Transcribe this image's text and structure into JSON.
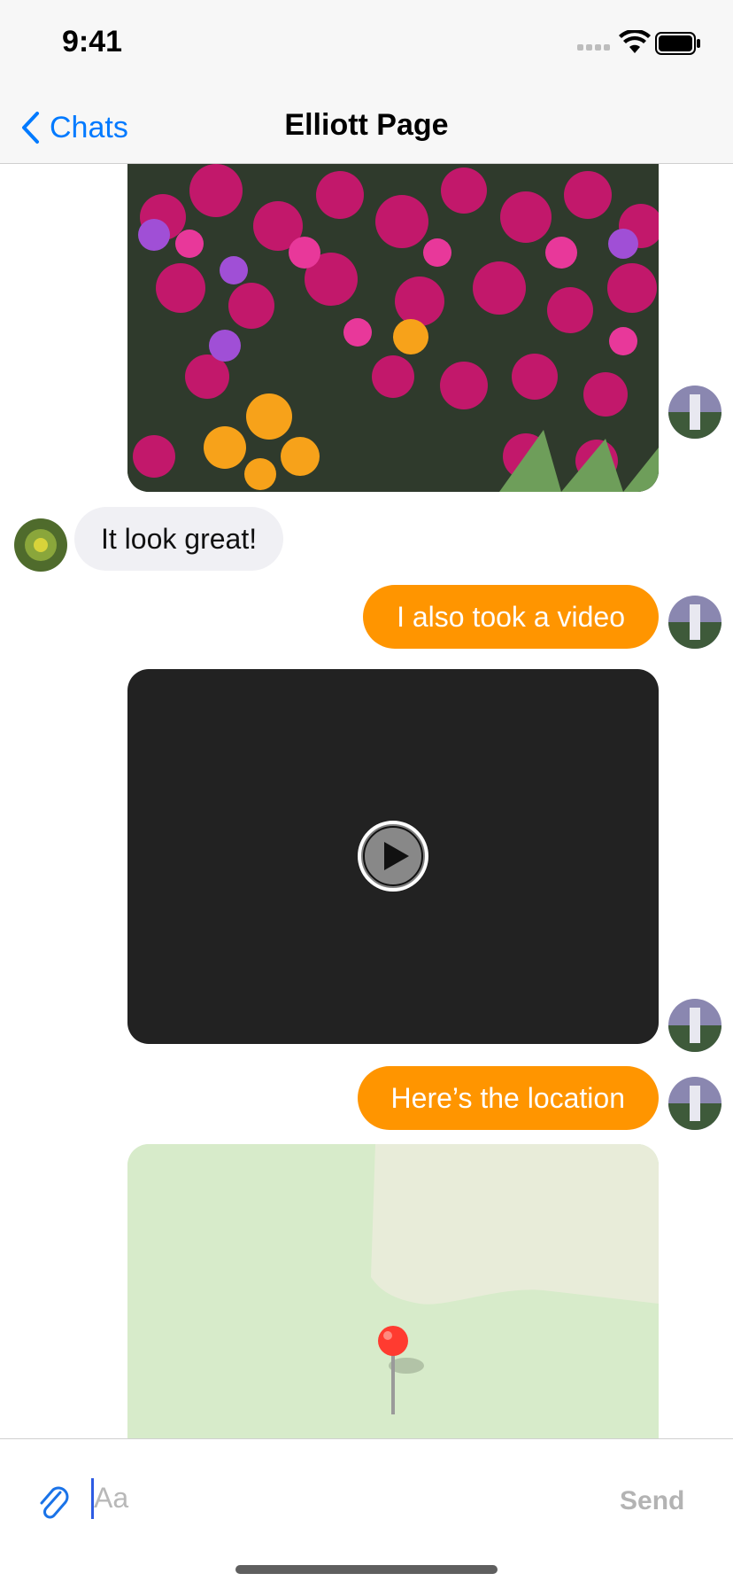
{
  "status_bar": {
    "time": "9:41"
  },
  "nav": {
    "back_label": "Chats",
    "title": "Elliott Page"
  },
  "messages": [
    {
      "type": "image",
      "direction": "outgoing",
      "content": "pink and yellow flowers photo"
    },
    {
      "type": "text",
      "direction": "incoming",
      "text": "It look great!"
    },
    {
      "type": "text",
      "direction": "outgoing",
      "text": "I also took a video"
    },
    {
      "type": "video",
      "direction": "outgoing"
    },
    {
      "type": "text",
      "direction": "outgoing",
      "text": "Here’s the location"
    },
    {
      "type": "location",
      "direction": "outgoing"
    }
  ],
  "input": {
    "placeholder": "Aa",
    "value": "",
    "send_label": "Send"
  },
  "colors": {
    "accent": "#007aff",
    "outgoing_bubble": "#ff9500",
    "incoming_bubble": "#f0f0f4",
    "map_green": "#d7ebca",
    "map_road": "#e8ecd9",
    "pin": "#ff3b30"
  }
}
